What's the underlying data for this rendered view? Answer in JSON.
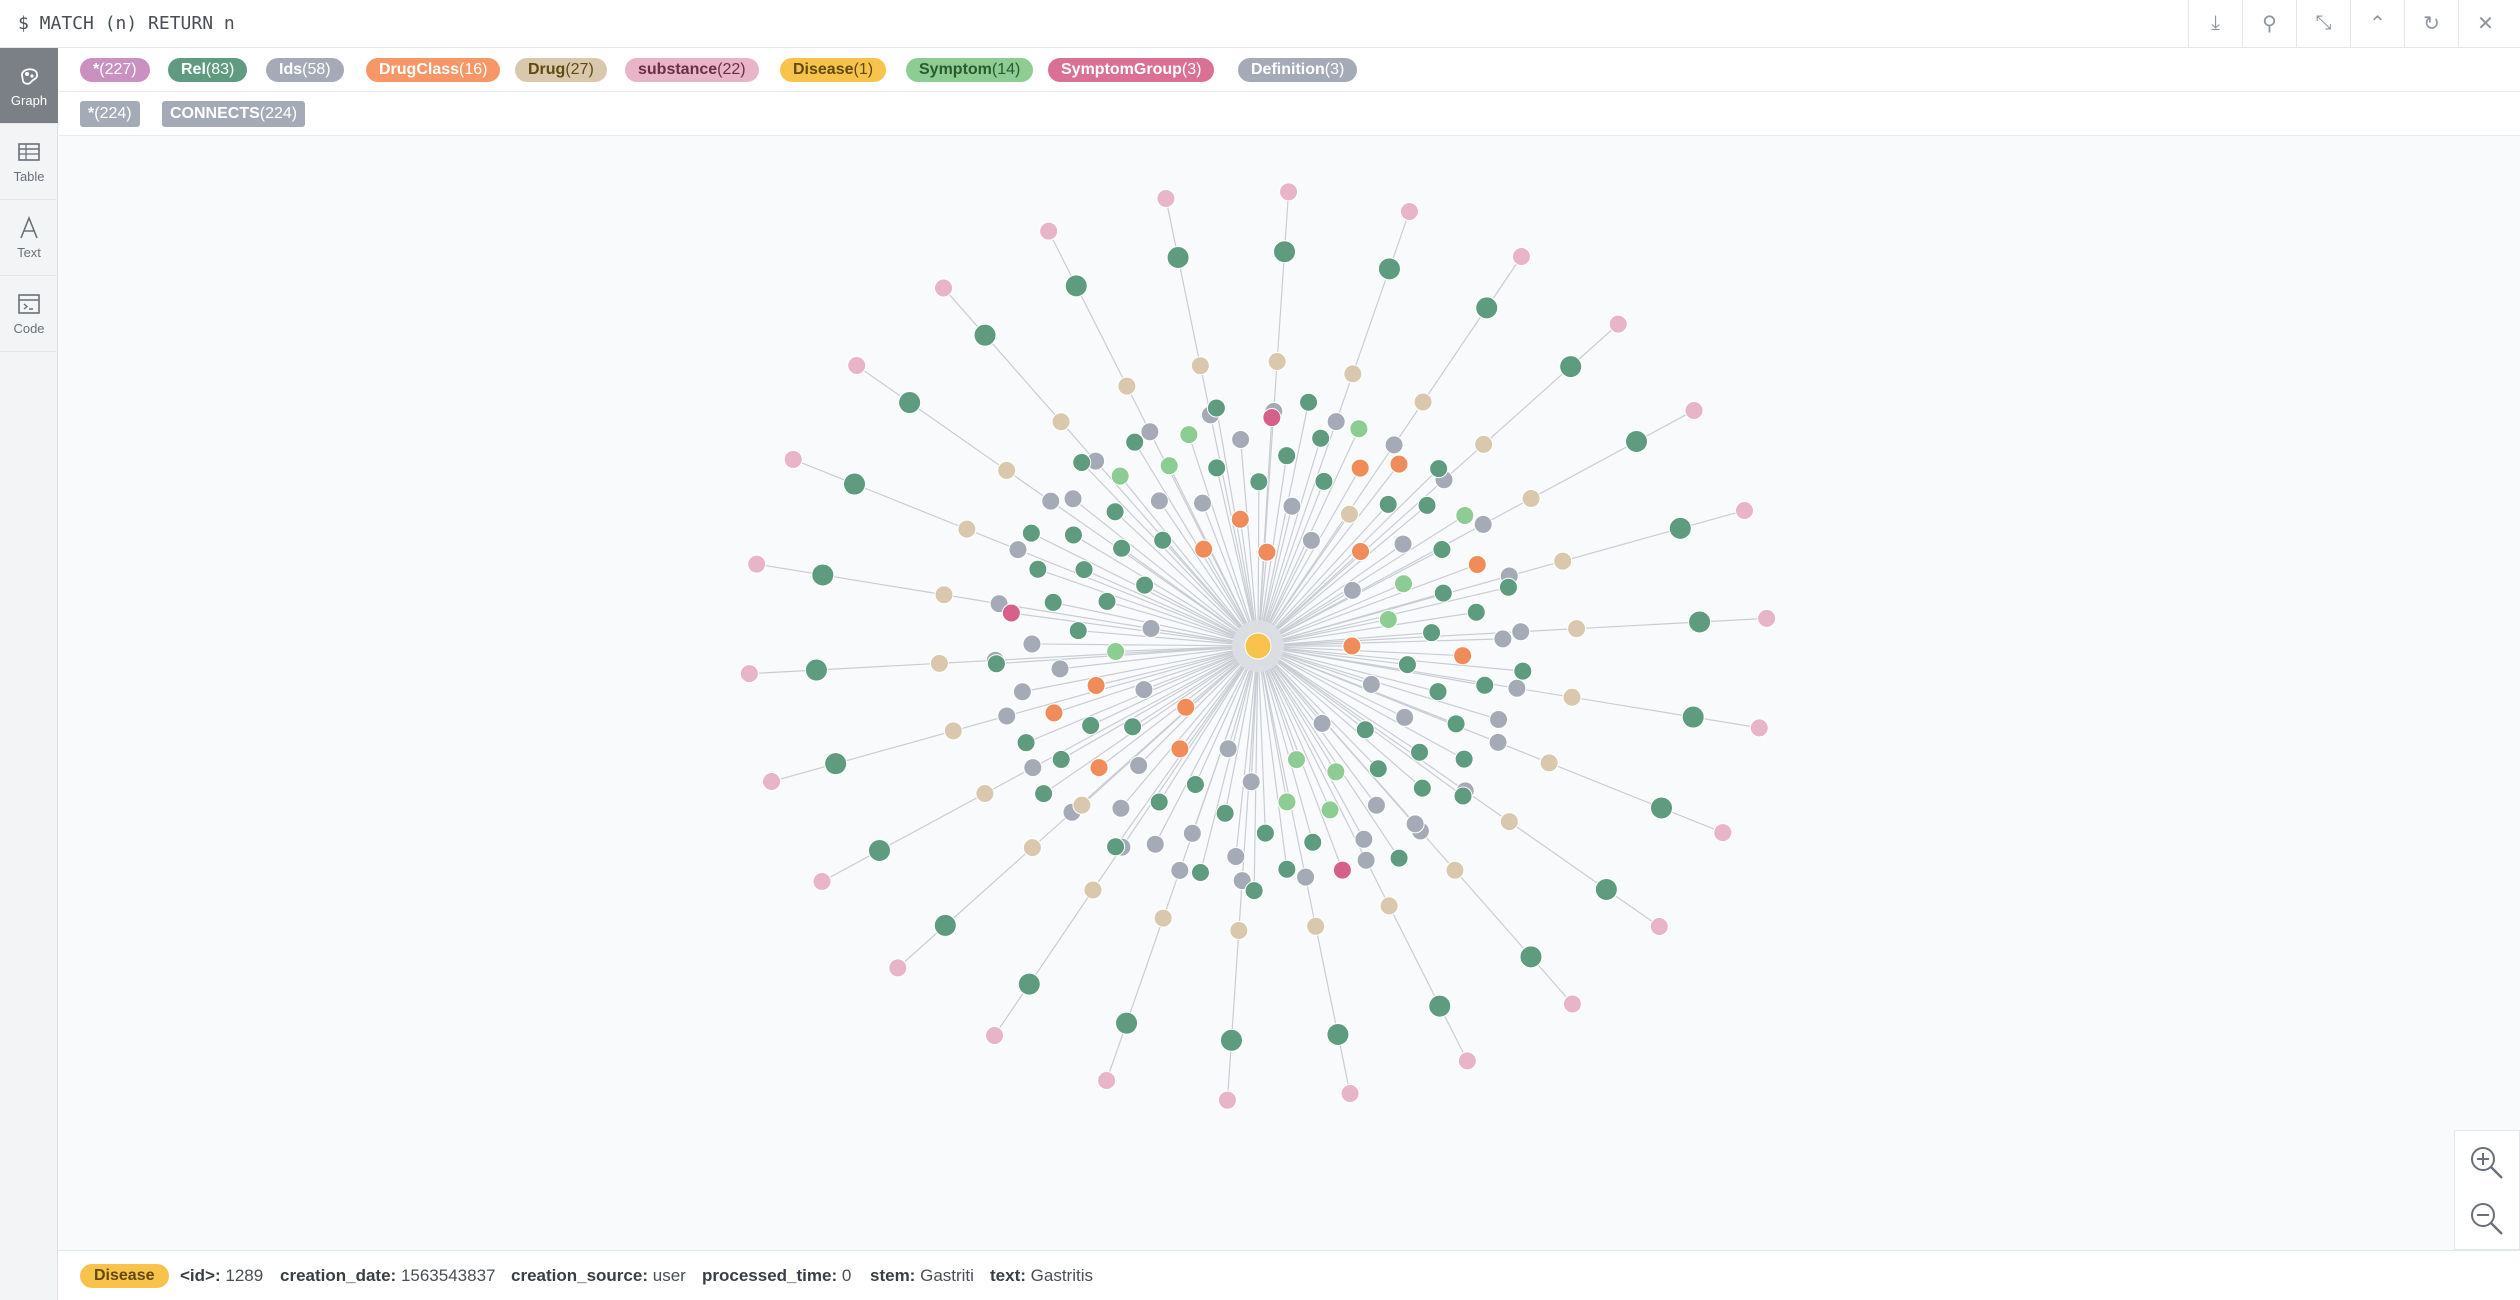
{
  "query": {
    "text": "$ MATCH (n) RETURN n"
  },
  "toolbar": {
    "buttons": [
      {
        "name": "download-icon",
        "glyph": "⤓"
      },
      {
        "name": "pin-icon",
        "glyph": "⚲"
      },
      {
        "name": "collapse-icon",
        "glyph": "⤡"
      },
      {
        "name": "chevron-up-icon",
        "glyph": "⌃"
      },
      {
        "name": "refresh-icon",
        "glyph": "↻"
      },
      {
        "name": "close-icon",
        "glyph": "✕"
      }
    ]
  },
  "sidebar": {
    "tabs": [
      {
        "label": "Graph",
        "active": true,
        "icon": "graph-icon"
      },
      {
        "label": "Table",
        "active": false,
        "icon": "table-icon"
      },
      {
        "label": "Text",
        "active": false,
        "icon": "text-icon"
      },
      {
        "label": "Code",
        "active": false,
        "icon": "code-icon"
      }
    ]
  },
  "node_labels": [
    {
      "name": "*",
      "count": "(227)",
      "color": "#c990c0",
      "text_color": "#ffffff"
    },
    {
      "name": "Rel",
      "count": "(83)",
      "color": "#57c7e3",
      "text_color": "#ffffff"
    },
    {
      "name": "Ids",
      "count": "(58)",
      "color": "#a5abb6",
      "text_color": "#ffffff"
    },
    {
      "name": "DrugClass",
      "count": "(16)",
      "color": "#f79767",
      "text_color": "#ffffff"
    },
    {
      "name": "Drug",
      "count": "(27)",
      "color": "#d9c8ae",
      "text_color": "#604a0e"
    },
    {
      "name": "substance",
      "count": "(22)",
      "color": "#e8b4c8",
      "text_color": "#6b2e45"
    },
    {
      "name": "Disease",
      "count": "(1)",
      "color": "#f7c34b",
      "text_color": "#604a0e"
    },
    {
      "name": "Symptom",
      "count": "(14)",
      "color": "#8dcc93",
      "text_color": "#2a5a2e"
    },
    {
      "name": "SymptomGroup",
      "count": "(3)",
      "color": "#da7194",
      "text_color": "#ffffff"
    },
    {
      "name": "Definition",
      "count": "(3)",
      "color": "#a5abb6",
      "text_color": "#ffffff"
    }
  ],
  "rel_types": [
    {
      "name": "*",
      "count": "(224)"
    },
    {
      "name": "CONNECTS",
      "count": "(224)"
    }
  ],
  "colors": {
    "rel_node": "#5e9b7f",
    "ids_node": "#a5abb6",
    "drugclass_node": "#f08c59",
    "drug_node": "#d9c8ae",
    "substance_node": "#e8b4c8",
    "disease_node": "#f7c34b",
    "symptom_node": "#8dcc93",
    "symptomgroup_node": "#d7608a",
    "edge": "#c9cdd3"
  },
  "status": {
    "label": "Disease",
    "properties": [
      {
        "key": "<id>:",
        "value": "1289"
      },
      {
        "key": "creation_date:",
        "value": "1563543837"
      },
      {
        "key": "creation_source:",
        "value": "user"
      },
      {
        "key": "processed_time:",
        "value": "0"
      },
      {
        "key": "stem:",
        "value": "Gastriti"
      },
      {
        "key": "text:",
        "value": "Gastritis"
      }
    ]
  }
}
